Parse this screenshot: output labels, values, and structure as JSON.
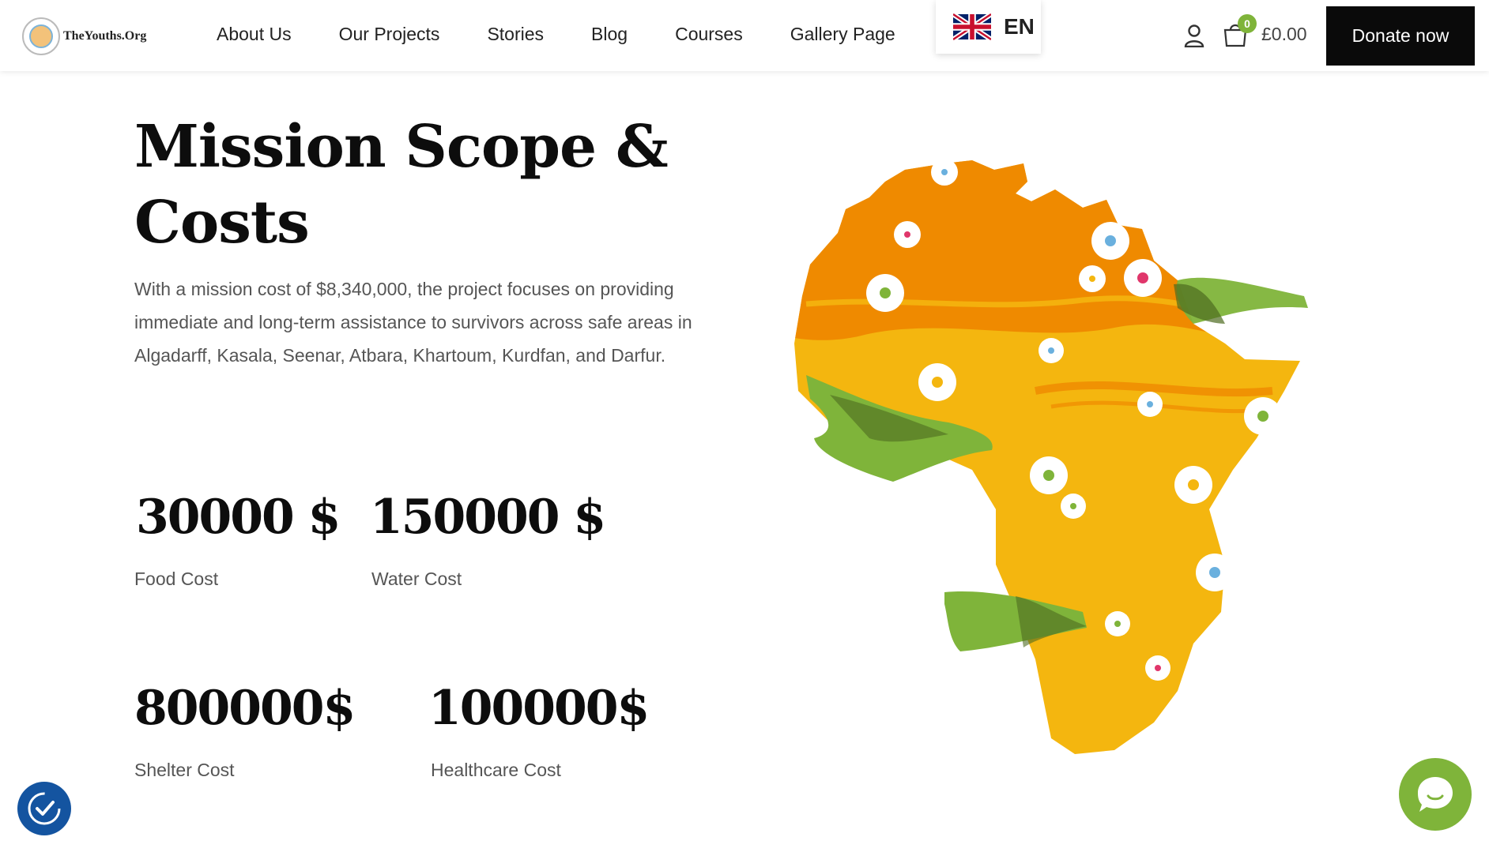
{
  "header": {
    "logo_text": "TheYouths.Org",
    "nav": [
      "About Us",
      "Our Projects",
      "Stories",
      "Blog",
      "Courses",
      "Gallery Page"
    ],
    "language": "EN",
    "cart_count": "0",
    "cart_total": "£0.00",
    "donate_label": "Donate now"
  },
  "main": {
    "title": "Mission Scope & Costs",
    "description": "With a mission cost of $8,340,000, the project focuses on providing immediate and long-term assistance to survivors across safe areas in Algadarff, Kasala, Seenar, Atbara, Khartoum, Kurdfan, and Darfur.",
    "stats": [
      {
        "value": "30000 $",
        "label": "Food Cost"
      },
      {
        "value": "150000 $",
        "label": "Water Cost"
      },
      {
        "value": "800000$",
        "label": "Shelter Cost"
      },
      {
        "value": "100000$",
        "label": "Healthcare Cost"
      }
    ]
  },
  "colors": {
    "accent_green": "#7fb43a",
    "map_orange": "#ef8a00",
    "map_yellow": "#f4b60f",
    "accessibility_blue": "#1454a0",
    "donate_bg": "#0a0a0a"
  },
  "icons": {
    "user": "user-icon",
    "cart": "cart-icon",
    "accessibility": "accessibility-icon",
    "chat": "chat-icon",
    "flag": "uk-flag-icon"
  }
}
